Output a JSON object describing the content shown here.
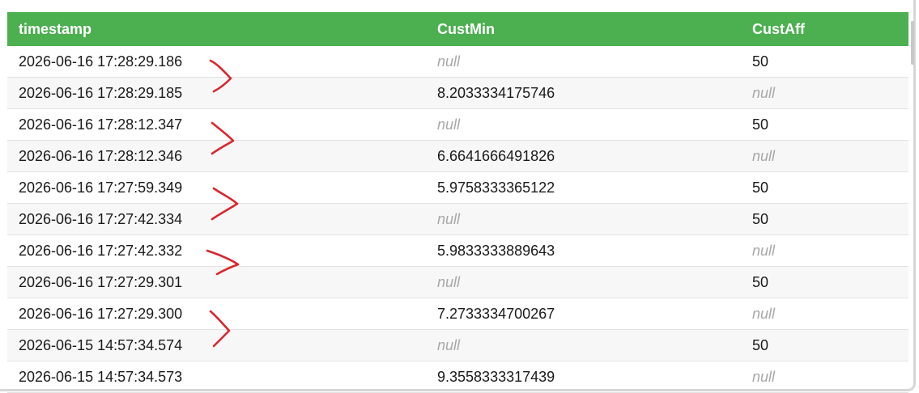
{
  "table": {
    "columns": [
      "timestamp",
      "CustMin",
      "CustAff"
    ],
    "rows": [
      {
        "timestamp": "2026-06-16 17:28:29.186",
        "custmin": "null",
        "custaff": "50"
      },
      {
        "timestamp": "2026-06-16 17:28:29.185",
        "custmin": "8.2033334175746",
        "custaff": "null"
      },
      {
        "timestamp": "2026-06-16 17:28:12.347",
        "custmin": "null",
        "custaff": "50"
      },
      {
        "timestamp": "2026-06-16 17:28:12.346",
        "custmin": "6.6641666491826",
        "custaff": "null"
      },
      {
        "timestamp": "2026-06-16 17:27:59.349",
        "custmin": "5.9758333365122",
        "custaff": "50"
      },
      {
        "timestamp": "2026-06-16 17:27:42.334",
        "custmin": "null",
        "custaff": "50"
      },
      {
        "timestamp": "2026-06-16 17:27:42.332",
        "custmin": "5.9833333889643",
        "custaff": "null"
      },
      {
        "timestamp": "2026-06-16 17:27:29.301",
        "custmin": "null",
        "custaff": "50"
      },
      {
        "timestamp": "2026-06-16 17:27:29.300",
        "custmin": "7.2733334700267",
        "custaff": "null"
      },
      {
        "timestamp": "2026-06-15 14:57:34.574",
        "custmin": "null",
        "custaff": "50"
      },
      {
        "timestamp": "2026-06-15 14:57:34.573",
        "custmin": "9.3558333317439",
        "custaff": "null"
      }
    ]
  },
  "colors": {
    "header_bg": "#4caf50",
    "header_text": "#ffffff",
    "null_text": "#a8a8a8",
    "annotation": "#d9262c"
  }
}
